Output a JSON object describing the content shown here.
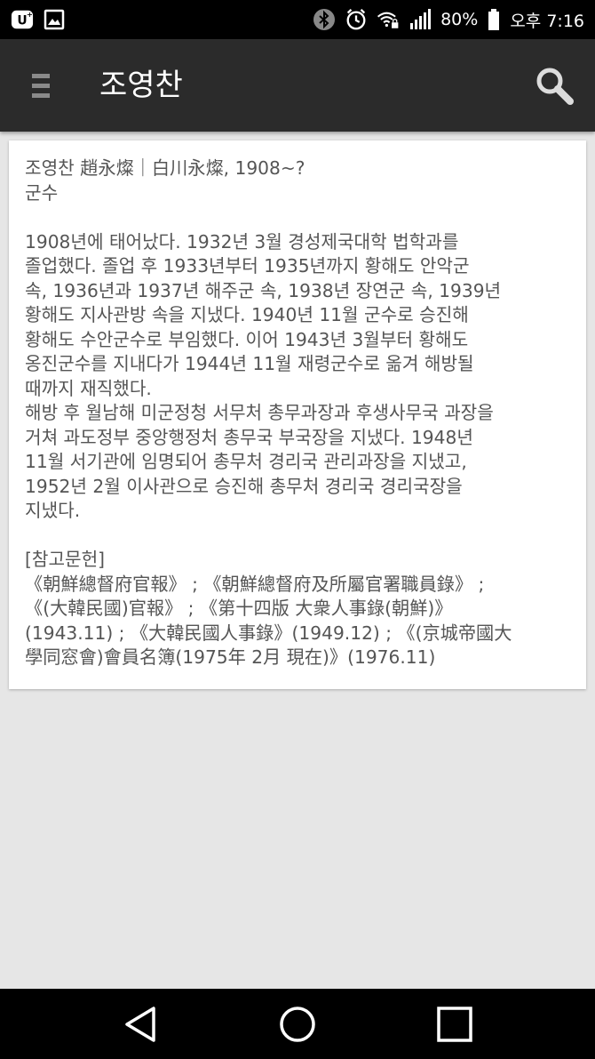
{
  "status_bar": {
    "battery_percent": "80%",
    "time": "오후 7:16",
    "icons": [
      "u-plus-icon",
      "image-notification-icon",
      "bluetooth-icon",
      "alarm-icon",
      "wifi-lock-icon",
      "signal-icon",
      "battery-icon"
    ]
  },
  "app_bar": {
    "title": "조영찬",
    "menu_icon": "hamburger-menu-icon",
    "search_icon": "search-icon"
  },
  "entry": {
    "heading": "조영찬 趙永燦｜白川永燦, 1908~?",
    "occupation": "군수",
    "biography_p1_lines": [
      "1908년에 태어났다. 1932년 3월 경성제국대학 법학과를",
      "졸업했다. 졸업 후 1933년부터 1935년까지 황해도 안악군",
      "속, 1936년과 1937년 해주군 속, 1938년 장연군 속, 1939년",
      "황해도 지사관방 속을 지냈다. 1940년 11월 군수로 승진해",
      "황해도 수안군수로 부임했다. 이어 1943년 3월부터 황해도",
      "옹진군수를 지내다가 1944년 11월 재령군수로 옮겨 해방될",
      "때까지 재직했다."
    ],
    "biography_p2_lines": [
      "해방 후 월남해 미군정청 서무처 총무과장과 후생사무국 과장을",
      "거쳐 과도정부 중앙행정처 총무국 부국장을 지냈다. 1948년",
      "11월 서기관에 임명되어 총무처 경리국 관리과장을 지냈고,",
      "1952년 2월 이사관으로 승진해 총무처 경리국 경리국장을",
      "지냈다."
    ],
    "references_heading": "[참고문헌]",
    "references_lines": [
      "《朝鮮總督府官報》 ; 《朝鮮總督府及所屬官署職員錄》 ;",
      "《(大韓民國)官報》 ; 《第十四版 大衆人事錄(朝鮮)》",
      "(1943.11) ; 《大韓民國人事錄》(1949.12) ; 《(京城帝國大",
      "學同窓會)會員名簿(1975年 2月 現在)》(1976.11)"
    ]
  },
  "nav_bar": {
    "back_icon": "back-triangle-icon",
    "home_icon": "home-circle-icon",
    "recents_icon": "recents-square-icon"
  }
}
